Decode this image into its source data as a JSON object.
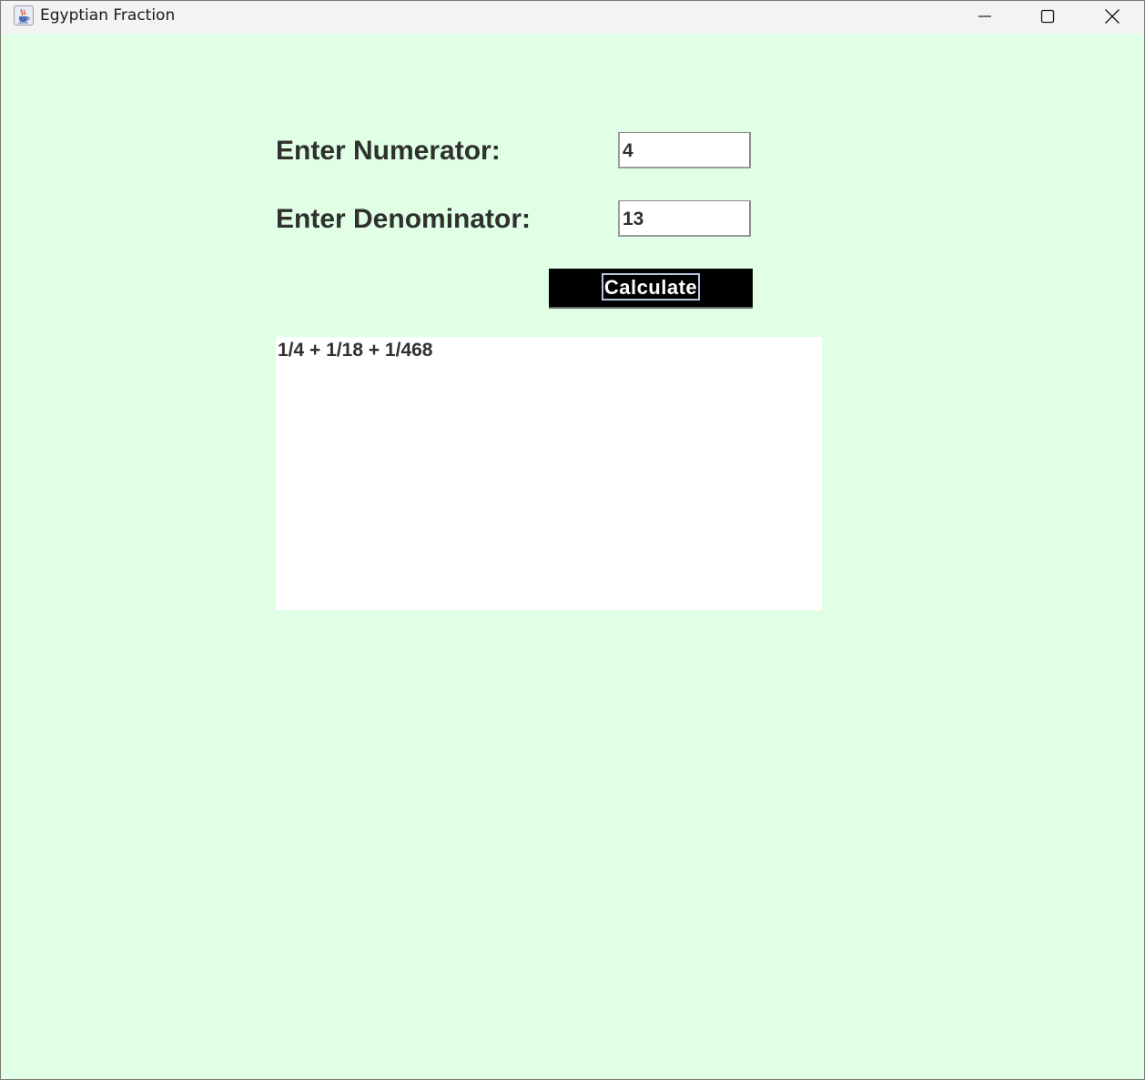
{
  "window": {
    "title": "Egyptian Fraction",
    "app_icon": "java-cup-icon",
    "controls": {
      "minimize_icon": "minimize-icon",
      "maximize_icon": "maximize-icon",
      "close_icon": "close-icon"
    }
  },
  "form": {
    "numerator_label": "Enter Numerator:",
    "numerator_value": "4",
    "denominator_label": "Enter Denominator:",
    "denominator_value": "13",
    "calculate_label": "Calculate"
  },
  "result": {
    "text": "1/4 + 1/18 + 1/468"
  },
  "colors": {
    "background": "#e0ffe4",
    "button": "#000000",
    "label_text": "#2f302f"
  }
}
